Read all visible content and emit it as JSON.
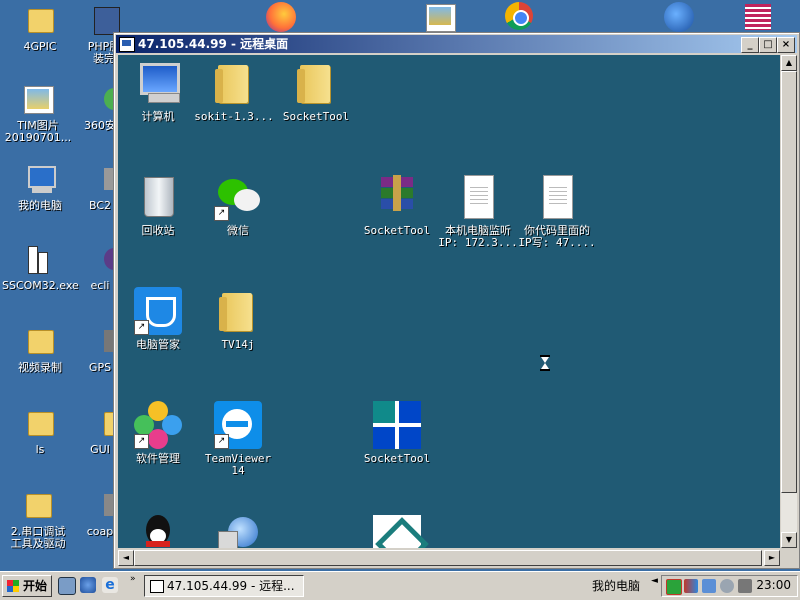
{
  "outer_desktop": {
    "icons": [
      {
        "label": "4GPIC",
        "icon": "folder-icon"
      },
      {
        "label": "PHP服\n装完",
        "icon": "installer-icon"
      },
      {
        "label": "TIM图片\n20190701...",
        "icon": "image-icon"
      },
      {
        "label": "360安",
        "icon": "security-icon"
      },
      {
        "label": "我的电脑",
        "icon": "computer-icon"
      },
      {
        "label": "BC2",
        "icon": "app-icon"
      },
      {
        "label": "SSCOM32.exe",
        "icon": "serial-tool-icon"
      },
      {
        "label": "ecli",
        "icon": "eclipse-icon"
      },
      {
        "label": "视频录制",
        "icon": "folder-icon"
      },
      {
        "label": "GPS",
        "icon": "app-icon"
      },
      {
        "label": "ls",
        "icon": "folder-icon"
      },
      {
        "label": "GUI",
        "icon": "folder-icon"
      },
      {
        "label": "2.串口调试\n工具及驱动",
        "icon": "folder-icon"
      },
      {
        "label": "coap",
        "icon": "app-icon"
      }
    ]
  },
  "rdp_window": {
    "title": "47.105.44.99 - 远程桌面",
    "buttons": {
      "minimize": "_",
      "maximize": "□",
      "close": "×"
    }
  },
  "inner_desktop": {
    "icons": [
      {
        "label": "计算机",
        "icon": "computer-icon"
      },
      {
        "label": "sokit-1.3...",
        "icon": "folder-icon"
      },
      {
        "label": "SocketTool",
        "icon": "folder-icon"
      },
      {
        "label": "回收站",
        "icon": "recycle-bin-icon"
      },
      {
        "label": "微信",
        "icon": "wechat-icon"
      },
      {
        "label": "SocketTool",
        "icon": "winrar-archive-icon"
      },
      {
        "label": "本机电脑监听\nIP: 172.3...",
        "icon": "text-document-icon"
      },
      {
        "label": "你代码里面的\nIP写: 47....",
        "icon": "text-document-icon"
      },
      {
        "label": "电脑管家",
        "icon": "tencent-pc-manager-icon"
      },
      {
        "label": "TV14j",
        "icon": "folder-icon"
      },
      {
        "label": "软件管理",
        "icon": "software-manager-icon"
      },
      {
        "label": "TeamViewer\n14",
        "icon": "teamviewer-icon"
      },
      {
        "label": "SocketTool",
        "icon": "sockettool-app-icon"
      },
      {
        "label": "",
        "icon": "qq-icon"
      },
      {
        "label": "",
        "icon": "network-icon"
      },
      {
        "label": "",
        "icon": "app-icon"
      }
    ]
  },
  "taskbar": {
    "start_label": "开始",
    "task_item_label": "47.105.44.99 - 远程...",
    "desktop_label": "我的电脑",
    "arrow": "◄",
    "clock": "23:00"
  }
}
